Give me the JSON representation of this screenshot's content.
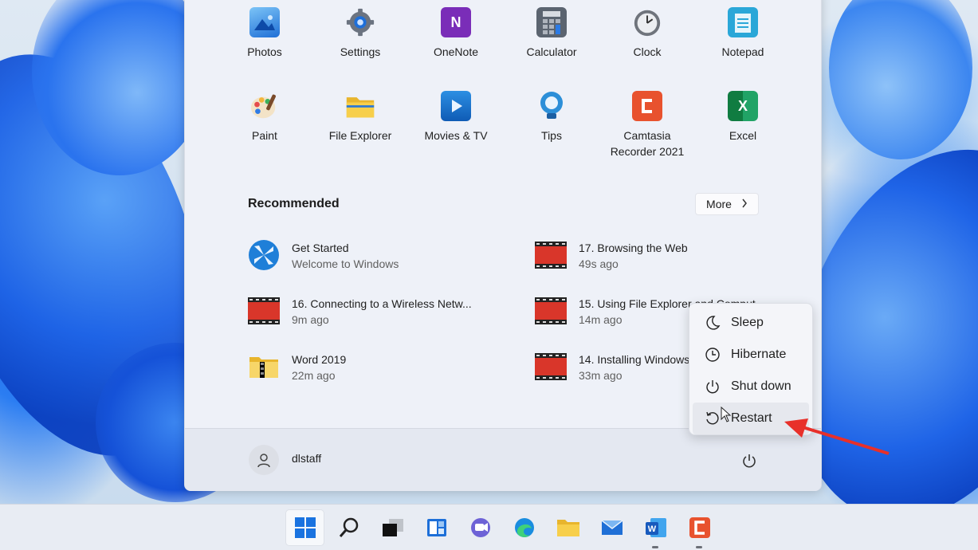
{
  "pinned_apps": [
    {
      "label": "Photos",
      "icon": "photos-icon",
      "color": "#1f6fd6"
    },
    {
      "label": "Settings",
      "icon": "settings-gear-icon",
      "color": "#6b7380"
    },
    {
      "label": "OneNote",
      "icon": "onenote-icon",
      "color": "#7a2db8"
    },
    {
      "label": "Calculator",
      "icon": "calculator-icon",
      "color": "#5b6470"
    },
    {
      "label": "Clock",
      "icon": "clock-icon",
      "color": "#7a7f87"
    },
    {
      "label": "Notepad",
      "icon": "notepad-icon",
      "color": "#2aa7d8"
    },
    {
      "label": "Paint",
      "icon": "paint-palette-icon",
      "color": "#f2a93b"
    },
    {
      "label": "File Explorer",
      "icon": "folder-icon",
      "color": "#f4c542"
    },
    {
      "label": "Movies & TV",
      "icon": "movies-tv-icon",
      "color": "#1773c9"
    },
    {
      "label": "Tips",
      "icon": "tips-lightbulb-icon",
      "color": "#2c8fd8"
    },
    {
      "label": "Camtasia\nRecorder 2021",
      "icon": "camtasia-icon",
      "color": "#e8522e"
    },
    {
      "label": "Excel",
      "icon": "excel-icon",
      "color": "#1d7a44"
    }
  ],
  "recommended": {
    "title": "Recommended",
    "more_label": "More",
    "items": [
      {
        "name": "Get Started",
        "sub": "Welcome to Windows",
        "icon": "get-started-icon"
      },
      {
        "name": "17. Browsing the Web",
        "sub": "49s ago",
        "icon": "video-file-icon"
      },
      {
        "name": "16. Connecting to a Wireless Netw...",
        "sub": "9m ago",
        "icon": "video-file-icon"
      },
      {
        "name": "15. Using File Explorer and Comput...",
        "sub": "14m ago",
        "icon": "video-file-icon"
      },
      {
        "name": "Word 2019",
        "sub": "22m ago",
        "icon": "zip-folder-icon"
      },
      {
        "name": "14. Installing Windows...",
        "sub": "33m ago",
        "icon": "video-file-icon"
      }
    ]
  },
  "user": {
    "name": "dlstaff"
  },
  "power_menu": {
    "items": [
      {
        "label": "Sleep",
        "icon": "moon-icon"
      },
      {
        "label": "Hibernate",
        "icon": "clock-outline-icon"
      },
      {
        "label": "Shut down",
        "icon": "power-icon"
      },
      {
        "label": "Restart",
        "icon": "restart-icon"
      }
    ]
  },
  "taskbar": {
    "icons": [
      "windows-start-icon",
      "search-icon",
      "task-view-icon",
      "widgets-icon",
      "teams-chat-icon",
      "edge-icon",
      "file-explorer-icon",
      "mail-icon",
      "word-icon",
      "camtasia-icon"
    ]
  }
}
